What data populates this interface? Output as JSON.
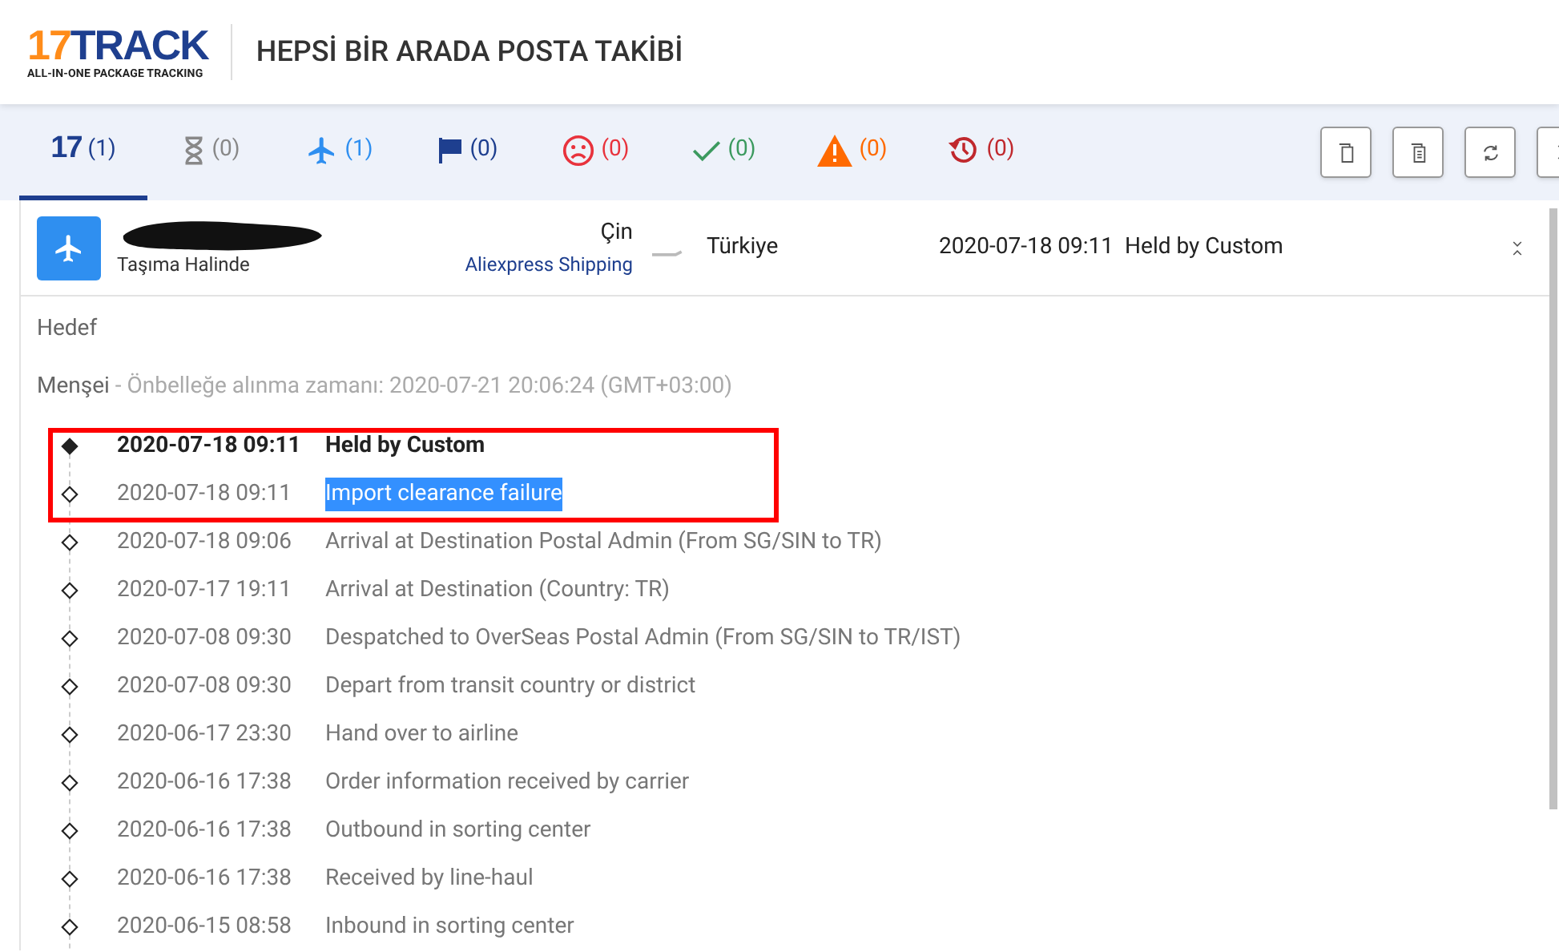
{
  "header": {
    "logo_number": "17",
    "logo_word": "TRACK",
    "logo_tagline": "ALL-IN-ONE PACKAGE TRACKING",
    "title": "HEPSİ BİR ARADA POSTA TAKİBİ"
  },
  "tabs": [
    {
      "kind": "all",
      "count": "(1)",
      "selected": true,
      "color": "#1e3f8f",
      "logo": "17"
    },
    {
      "kind": "pending",
      "count": "(0)",
      "selected": false,
      "color": "#888888"
    },
    {
      "kind": "transit",
      "count": "(1)",
      "selected": false,
      "color": "#2f8ff0"
    },
    {
      "kind": "pickup",
      "count": "(0)",
      "selected": false,
      "color": "#1e3f8f"
    },
    {
      "kind": "undelivered",
      "count": "(0)",
      "selected": false,
      "color": "#e8323c"
    },
    {
      "kind": "delivered",
      "count": "(0)",
      "selected": false,
      "color": "#3c9a5f"
    },
    {
      "kind": "alert",
      "count": "(0)",
      "selected": false,
      "color": "#ff6a00"
    },
    {
      "kind": "expired",
      "count": "(0)",
      "selected": false,
      "color": "#c0282d"
    }
  ],
  "toolbar": [
    {
      "kind": "copy"
    },
    {
      "kind": "copy-list"
    },
    {
      "kind": "refresh"
    },
    {
      "kind": "collapse"
    }
  ],
  "shipment": {
    "status": "Taşıma Halinde",
    "origin": "Çin",
    "carrier": "Aliexpress Shipping",
    "destination": "Türkiye",
    "latest_time": "2020-07-18 09:11",
    "latest_event": "Held by Custom"
  },
  "destination_label": "Hedef",
  "origin_line": {
    "label": "Menşei",
    "note": " - Önbelleğe alınma zamanı: 2020-07-21 20:06:24 (GMT+03:00)"
  },
  "events": [
    {
      "time": "2020-07-18 09:11",
      "text": "Held by Custom",
      "latest": true,
      "selected": false
    },
    {
      "time": "2020-07-18 09:11",
      "text": "Import clearance failure",
      "latest": false,
      "selected": true
    },
    {
      "time": "2020-07-18 09:06",
      "text": "Arrival at Destination Postal Admin (From SG/SIN to TR)",
      "latest": false,
      "selected": false
    },
    {
      "time": "2020-07-17 19:11",
      "text": "Arrival at Destination (Country: TR)",
      "latest": false,
      "selected": false
    },
    {
      "time": "2020-07-08 09:30",
      "text": "Despatched to OverSeas Postal Admin (From SG/SIN to TR/IST)",
      "latest": false,
      "selected": false
    },
    {
      "time": "2020-07-08 09:30",
      "text": "Depart from transit country or district",
      "latest": false,
      "selected": false
    },
    {
      "time": "2020-06-17 23:30",
      "text": "Hand over to airline",
      "latest": false,
      "selected": false
    },
    {
      "time": "2020-06-16 17:38",
      "text": "Order information received by carrier",
      "latest": false,
      "selected": false
    },
    {
      "time": "2020-06-16 17:38",
      "text": "Outbound in sorting center",
      "latest": false,
      "selected": false
    },
    {
      "time": "2020-06-16 17:38",
      "text": "Received by line-haul",
      "latest": false,
      "selected": false
    },
    {
      "time": "2020-06-15 08:58",
      "text": "Inbound in sorting center",
      "latest": false,
      "selected": false
    }
  ]
}
